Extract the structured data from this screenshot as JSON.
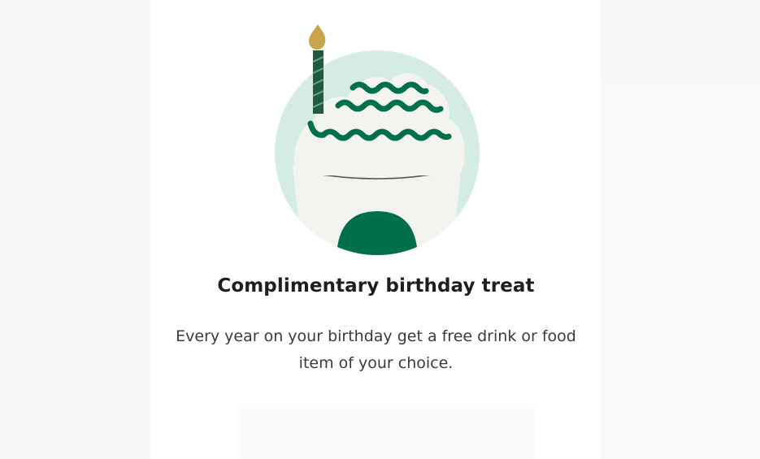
{
  "feature": {
    "title": "Complimentary birthday treat",
    "description": "Every year on your birthday get a free drink or food item of your choice."
  },
  "illustration": {
    "icon": "birthday-frappuccino-candle",
    "colors": {
      "circle_bg": "#d4ece4",
      "cream": "#f3f3ef",
      "green": "#00704a",
      "dark_green": "#1e5b3f",
      "flame": "#c9a54a"
    }
  },
  "colors": {
    "card": "#ffffff",
    "background": "#f8f6f6",
    "title_text": "#1e1e1e",
    "body_text": "#3a3a3a"
  }
}
